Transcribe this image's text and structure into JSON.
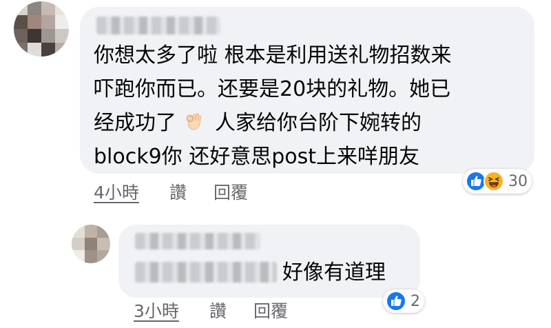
{
  "comments": [
    {
      "author_redacted": true,
      "lines": [
        "你想太多了啦 根本是利用送礼物招数来",
        "吓跑你而已。还要是20块的礼物。她已",
        [
          "经成功了",
          "人家给你台阶下婉转的"
        ],
        "block9你 还好意思post上来咩朋友"
      ],
      "emoji": "ok-hand-icon",
      "time": "4小時",
      "like_label": "讚",
      "reply_label": "回覆",
      "reactions": {
        "icons": [
          "like-icon",
          "haha-icon"
        ],
        "count": "30"
      }
    },
    {
      "author_redacted": true,
      "text": "好像有道理",
      "time": "3小時",
      "like_label": "讚",
      "reply_label": "回覆",
      "reactions": {
        "icons": [
          "like-icon"
        ],
        "count": "2"
      }
    }
  ],
  "colors": {
    "bubble": "#f0f2f5",
    "text": "#050505",
    "meta": "#65676b",
    "like_blue": "#1877f2",
    "haha_yellow": "#f7b125"
  }
}
